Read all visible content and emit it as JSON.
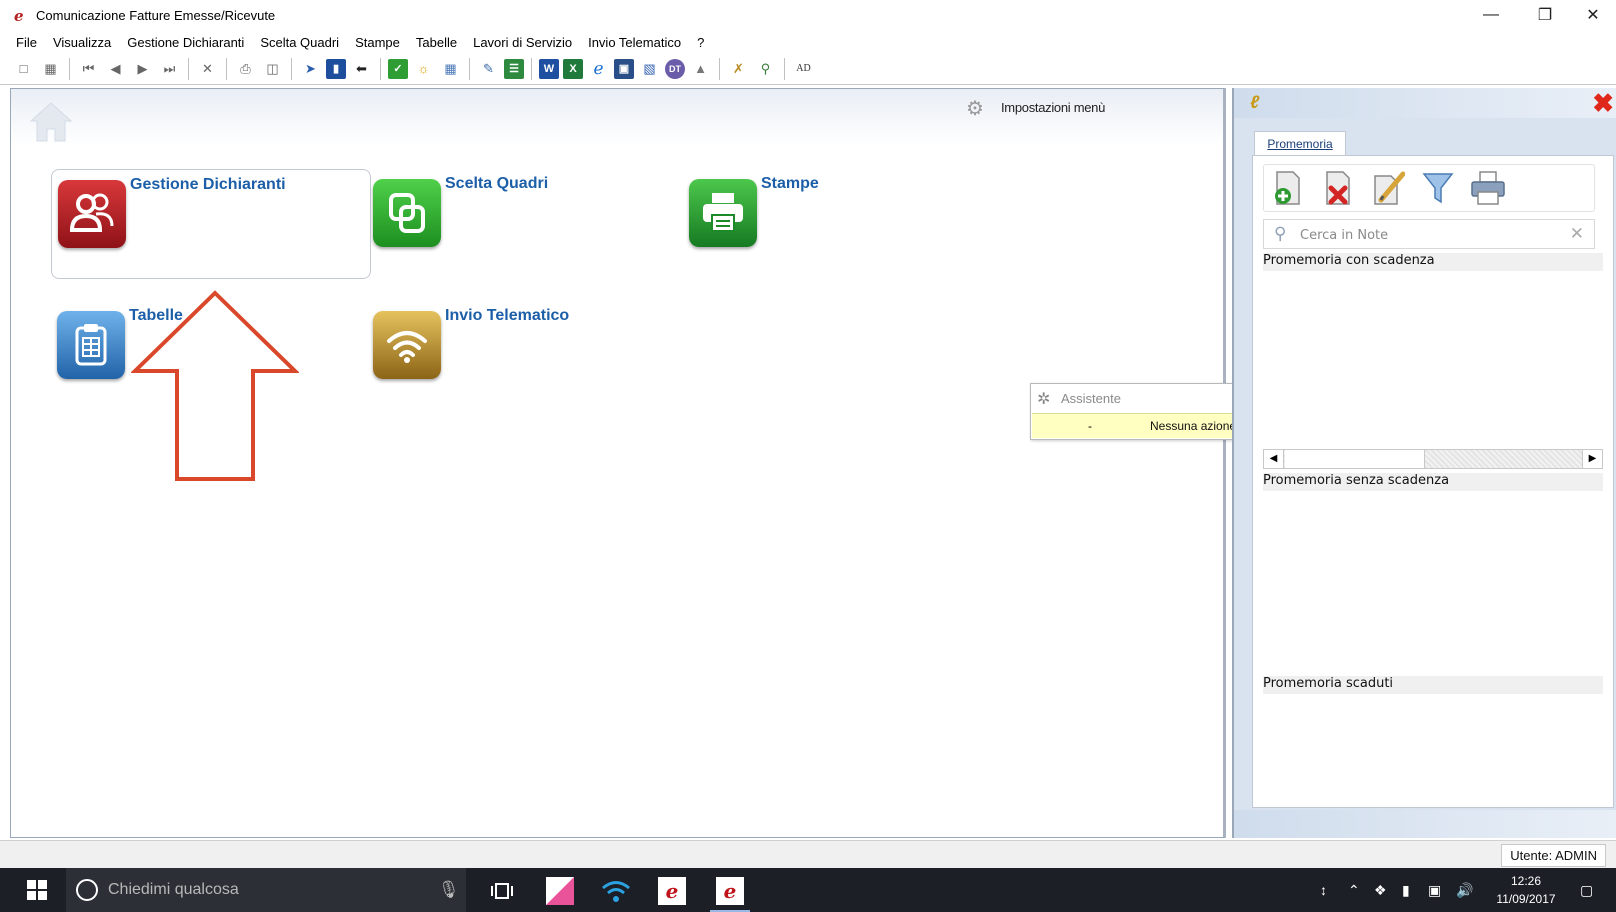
{
  "window": {
    "title": "Comunicazione Fatture Emesse/Ricevute",
    "app_logo": "e"
  },
  "menu": [
    "File",
    "Visualizza",
    "Gestione Dichiaranti",
    "Scelta Quadri",
    "Stampe",
    "Tabelle",
    "Lavori di Servizio",
    "Invio Telematico",
    "?"
  ],
  "toolbar": {
    "word_label": "W",
    "excel_label": "X",
    "dt_label": "DT",
    "ad_label": "AD"
  },
  "main": {
    "settings_label": "Impostazioni menù",
    "tiles": {
      "gestione": "Gestione Dichiaranti",
      "scelta": "Scelta Quadri",
      "stampe": "Stampe",
      "tabelle": "Tabelle",
      "invio": "Invio Telematico"
    }
  },
  "assistant": {
    "title": "Assistente",
    "row_dash": "-",
    "row_message": "Nessuna azione"
  },
  "side_panel": {
    "tab": "Promemoria",
    "search_placeholder": "Cerca in Note",
    "sections": [
      "Promemoria con scadenza",
      "Promemoria senza scadenza",
      "Promemoria scaduti"
    ]
  },
  "status": {
    "user": "Utente: ADMIN"
  },
  "taskbar": {
    "search_placeholder": "Chiedimi qualcosa",
    "time": "12:26",
    "date": "11/09/2017"
  },
  "colors": {
    "tile_label": "#1c5fa8",
    "gestione_icon": "#b51d22",
    "scelta_icon": "#2eae2b",
    "stampe_icon": "#2c9c36",
    "tabelle_icon": "#3b86c7",
    "invio_icon": "#b88d2e",
    "arrow": "#d9482a",
    "assistant_row": "#ffffc2"
  }
}
